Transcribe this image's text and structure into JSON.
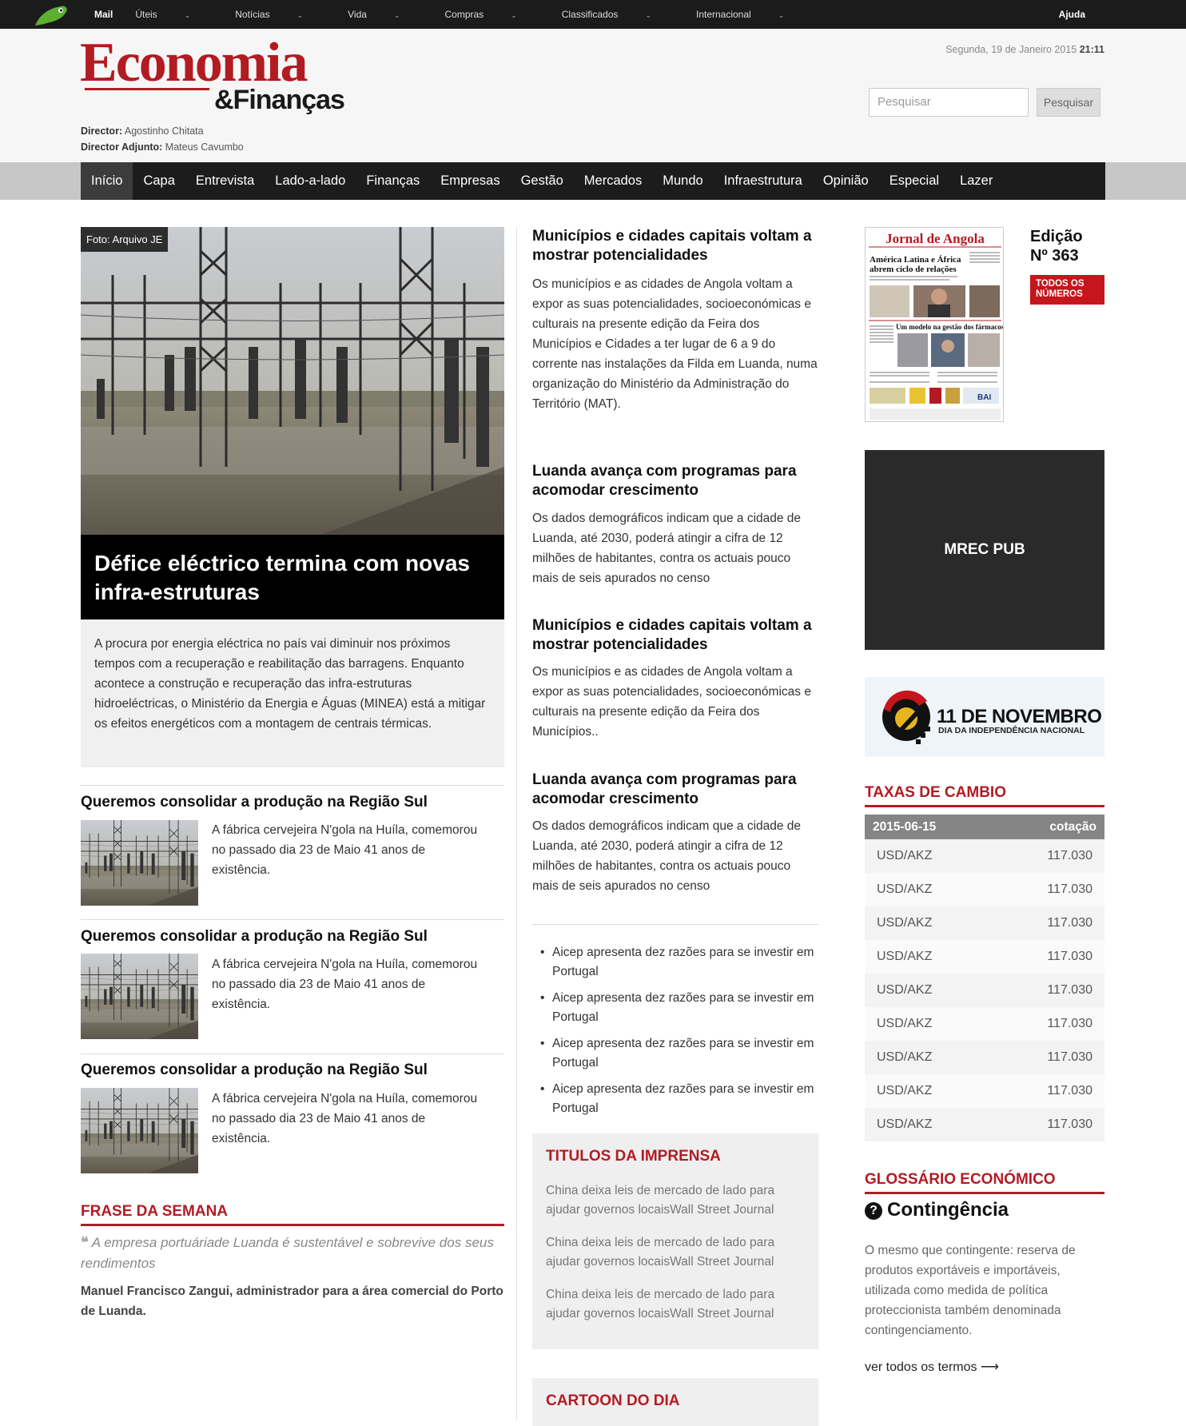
{
  "topbar": {
    "items": [
      "Mail",
      "Úteis",
      "Notícias",
      "Vida",
      "Compras",
      "Classificados",
      "Internacional"
    ],
    "help": "Ajuda"
  },
  "header": {
    "logo_main": "Economia",
    "logo_sub": "&Finanças",
    "director_label": "Director:",
    "director_name": "Agostinho Chitata",
    "adjunto_label": "Director Adjunto:",
    "adjunto_name": "Mateus Cavumbo",
    "date": "Segunda, 19 de Janeiro 2015",
    "time": "21:11",
    "search_placeholder": "Pesquisar",
    "search_button": "Pesquisar"
  },
  "nav": [
    "Início",
    "Capa",
    "Entrevista",
    "Lado-a-lado",
    "Finanças",
    "Empresas",
    "Gestão",
    "Mercados",
    "Mundo",
    "Infraestrutura",
    "Opinião",
    "Especial",
    "Lazer"
  ],
  "hero": {
    "caption": "Foto: Arquivo JE",
    "title": "Défice eléctrico termina com novas infra-estruturas",
    "text": "A procura por energia eléctrica no país vai diminuir nos próximos tempos com a recuperação e reabilitação das barragens. Enquanto acontece a construção e recuperação das infra-estruturas hidroeléctricas, o Ministério da Energia e Águas (MINEA) está a mitigar os efeitos energéticos com a montagem de centrais térmicas."
  },
  "left_items": [
    {
      "title": "Queremos consolidar a produção na Região Sul",
      "text": "A fábrica cervejeira N'gola na Huíla, comemorou no passado dia 23 de Maio 41 anos de existência."
    },
    {
      "title": "Queremos consolidar a produção na Região Sul",
      "text": "A fábrica cervejeira N'gola na Huíla, comemorou no passado dia 23 de Maio 41 anos de existência."
    },
    {
      "title": "Queremos consolidar a produção na Região Sul",
      "text": "A fábrica cervejeira N'gola na Huíla, comemorou no passado dia 23 de Maio 41 anos de existência."
    }
  ],
  "frase": {
    "heading": "FRASE DA SEMANA",
    "quote": "A empresa portuáriade Luanda é sustentável e sobrevive dos seus rendimentos",
    "author": "Manuel Francisco Zangui, administrador para a área comercial do Porto de Luanda."
  },
  "middle_articles": [
    {
      "title": "Municípios e cidades capitais voltam a mostrar potencialidades",
      "text": "Os municípios e as cidades de Angola voltam a expor as suas potencialidades, socioeconómicas e culturais na presente edição da Feira dos Municípios e Cidades a ter lugar de 6 a 9 do corrente nas instalações da Filda em Luanda, numa organização do Ministério da Administração do Território (MAT)."
    },
    {
      "title": "Luanda avança com programas para acomodar crescimento",
      "text": "Os dados demográficos indicam que a cidade de Luanda, até 2030, poderá atingir a cifra de 12 milhões de habitantes, contra os actuais pouco mais de seis apurados no censo"
    },
    {
      "title": "Municípios e cidades capitais voltam a mostrar potencialidades",
      "text": "Os municípios e as cidades de Angola voltam a expor as suas potencialidades, socioeconómicas e culturais na presente edição da Feira dos Municípios.."
    },
    {
      "title": "Luanda avança com programas para acomodar crescimento",
      "text": "Os dados demográficos indicam que a cidade de Luanda, até 2030, poderá atingir a cifra de 12 milhões de habitantes, contra os actuais pouco mais de seis apurados no censo"
    }
  ],
  "bullets": [
    "Aicep apresenta dez razões para se investir em Portugal",
    "Aicep apresenta dez razões para se investir em Portugal",
    "Aicep apresenta dez razões para se investir em Portugal",
    "Aicep apresenta dez razões para se investir em Portugal"
  ],
  "imprensa": {
    "heading": "TITULOS DA IMPRENSA",
    "items": [
      "China deixa leis de mercado de lado para ajudar governos locaisWall Street Journal",
      "China deixa leis de mercado de lado para ajudar governos locaisWall Street Journal",
      "China deixa leis de mercado de lado para ajudar governos locaisWall Street Journal"
    ]
  },
  "cartoon": {
    "heading": "CARTOON DO DIA"
  },
  "edition": {
    "paper_name": "Jornal de Angola",
    "paper_headline": "América Latina e África abrem ciclo de relações",
    "paper_sub": "Um modelo na gestão dos fármacos",
    "label": "Edição",
    "number": "Nº 363",
    "all_button_line1": "TODOS OS",
    "all_button_line2": "NÚMEROS"
  },
  "ad": {
    "mrec": "MREC PUB"
  },
  "banner": {
    "title": "11 DE NOVEMBRO",
    "subtitle": "DIA DA INDEPENDÊNCIA NACIONAL"
  },
  "fx": {
    "heading": "TAXAS DE CAMBIO",
    "date": "2015-06-15",
    "col": "cotação",
    "rows": [
      {
        "pair": "USD/AKZ",
        "value": "117.030"
      },
      {
        "pair": "USD/AKZ",
        "value": "117.030"
      },
      {
        "pair": "USD/AKZ",
        "value": "117.030"
      },
      {
        "pair": "USD/AKZ",
        "value": "117.030"
      },
      {
        "pair": "USD/AKZ",
        "value": "117.030"
      },
      {
        "pair": "USD/AKZ",
        "value": "117.030"
      },
      {
        "pair": "USD/AKZ",
        "value": "117.030"
      },
      {
        "pair": "USD/AKZ",
        "value": "117.030"
      },
      {
        "pair": "USD/AKZ",
        "value": "117.030"
      }
    ]
  },
  "glossario": {
    "heading": "GLOSSÁRIO ECONÓMICO",
    "term": "Contingência",
    "text": "O mesmo que contingente: reserva de produtos exportáveis e importáveis, utilizada como medida de política proteccionista também denominada contingenciamento.",
    "link": "ver todos os termos ⟶"
  },
  "colors": {
    "brand_red": "#b31b22",
    "nav_bg": "#1c1c1c",
    "topbar_bg": "#1b1b1b"
  }
}
